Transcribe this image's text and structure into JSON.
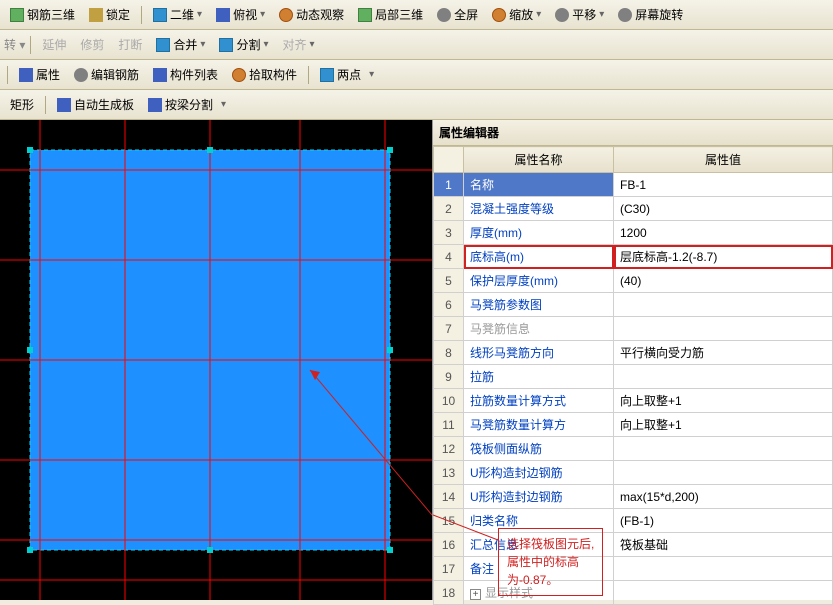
{
  "toolbars": {
    "row1": {
      "rebar3d": "钢筋三维",
      "lock": "锁定",
      "view2d": "二维",
      "overlook": "俯视",
      "dynobs": "动态观察",
      "local3d": "局部三维",
      "fullscreen": "全屏",
      "zoom": "缩放",
      "pan": "平移",
      "rotate": "屏幕旋转"
    },
    "row2": {
      "extend": "延伸",
      "trim": "修剪",
      "break": "打断",
      "merge": "合并",
      "split": "分割",
      "align": "对齐"
    },
    "row3": {
      "props": "属性",
      "editrebar": "编辑钢筋",
      "complist": "构件列表",
      "pickcomp": "拾取构件",
      "twopoint": "两点"
    },
    "row4": {
      "rect": "矩形",
      "autogen": "自动生成板",
      "splitby": "按梁分割"
    }
  },
  "prop": {
    "title": "属性编辑器",
    "col_name": "属性名称",
    "col_value": "属性值",
    "rows": [
      {
        "n": "1",
        "name": "名称",
        "val": "FB-1",
        "link": true,
        "sel": true
      },
      {
        "n": "2",
        "name": "混凝土强度等级",
        "val": "(C30)",
        "link": true
      },
      {
        "n": "3",
        "name": "厚度(mm)",
        "val": "1200",
        "link": true
      },
      {
        "n": "4",
        "name": "底标高(m)",
        "val": "层底标高-1.2(-8.7)",
        "link": true,
        "hl": true
      },
      {
        "n": "5",
        "name": "保护层厚度(mm)",
        "val": "(40)",
        "link": true
      },
      {
        "n": "6",
        "name": "马凳筋参数图",
        "val": "",
        "link": true
      },
      {
        "n": "7",
        "name": "马凳筋信息",
        "val": "",
        "muted": true
      },
      {
        "n": "8",
        "name": "线形马凳筋方向",
        "val": "平行横向受力筋",
        "link": true
      },
      {
        "n": "9",
        "name": "拉筋",
        "val": "",
        "link": true
      },
      {
        "n": "10",
        "name": "拉筋数量计算方式",
        "val": "向上取整+1",
        "link": true
      },
      {
        "n": "11",
        "name": "马凳筋数量计算方",
        "val": "向上取整+1",
        "link": true
      },
      {
        "n": "12",
        "name": "筏板侧面纵筋",
        "val": "",
        "link": true
      },
      {
        "n": "13",
        "name": "U形构造封边钢筋",
        "val": "",
        "link": true
      },
      {
        "n": "14",
        "name": "U形构造封边钢筋",
        "val": "max(15*d,200)",
        "link": true
      },
      {
        "n": "15",
        "name": "归类名称",
        "val": "(FB-1)",
        "link": true
      },
      {
        "n": "16",
        "name": "汇总信息",
        "val": "筏板基础",
        "link": true
      },
      {
        "n": "17",
        "name": "备注",
        "val": "",
        "link": true
      },
      {
        "n": "18",
        "name": "显示样式",
        "val": "",
        "muted": true,
        "expand": true
      }
    ]
  },
  "callout": {
    "l1": "选择筏板图元后,",
    "l2": "属性中的标高",
    "l3": "为-0.87。"
  }
}
